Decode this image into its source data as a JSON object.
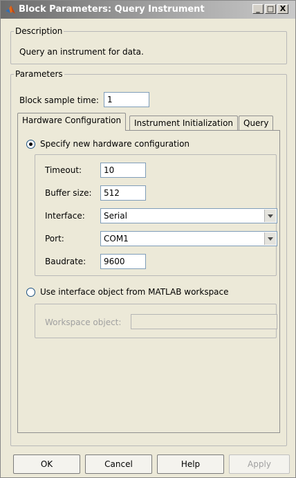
{
  "window": {
    "title": "Block Parameters: Query Instrument"
  },
  "titlebar_buttons": {
    "minimize": "_",
    "maximize": "□",
    "close": "X"
  },
  "description": {
    "legend": "Description",
    "text": "Query an instrument for data."
  },
  "parameters": {
    "legend": "Parameters",
    "sample_time_label": "Block sample time:",
    "sample_time_value": "1"
  },
  "tabs": [
    {
      "label": "Hardware Configuration",
      "active": true
    },
    {
      "label": "Instrument Initialization",
      "active": false
    },
    {
      "label": "Query",
      "active": false
    }
  ],
  "hardware": {
    "specify_new_label": "Specify new hardware configuration",
    "specify_new_checked": true,
    "timeout_label": "Timeout:",
    "timeout_value": "10",
    "buffer_label": "Buffer size:",
    "buffer_value": "512",
    "interface_label": "Interface:",
    "interface_value": "Serial",
    "port_label": "Port:",
    "port_value": "COM1",
    "baudrate_label": "Baudrate:",
    "baudrate_value": "9600",
    "use_workspace_label": "Use interface object from MATLAB workspace",
    "use_workspace_checked": false,
    "workspace_object_label": "Workspace object:",
    "workspace_object_value": ""
  },
  "buttons": {
    "ok": "OK",
    "cancel": "Cancel",
    "help": "Help",
    "apply": "Apply"
  },
  "icons": {
    "app": "matlab-logo-icon"
  }
}
